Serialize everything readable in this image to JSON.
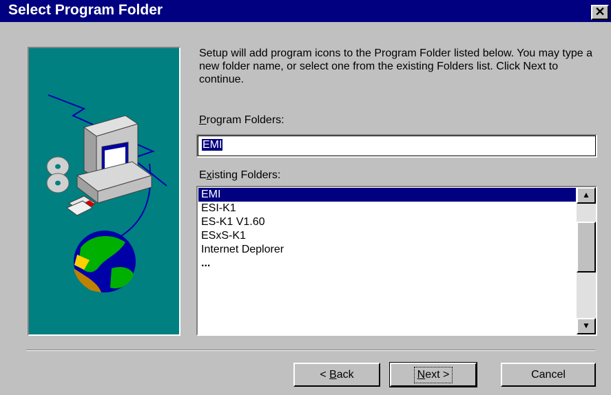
{
  "window": {
    "title": "Select Program Folder",
    "close_glyph": "✕"
  },
  "instructions": "Setup will add program icons to the Program Folder listed below.  You may type a new folder name, or select one from the existing Folders list.  Click Next to continue.",
  "program_folders": {
    "label_prefix": "",
    "label_accel": "P",
    "label_rest": "rogram Folders:",
    "value": "EMI"
  },
  "existing_folders": {
    "label_prefix": "E",
    "label_accel": "x",
    "label_rest": "isting Folders:",
    "items": [
      "EMI",
      "ESI-K1",
      "ES-K1 V1.60",
      "ESxS-K1",
      "Internet Deplorer",
      "..."
    ],
    "selected_index": 0
  },
  "scroll": {
    "up_icon": "▲",
    "down_icon": "▼"
  },
  "buttons": {
    "back": {
      "prefix": "< ",
      "accel": "B",
      "rest": "ack"
    },
    "next": {
      "prefix": "",
      "accel": "N",
      "rest": "ext >"
    },
    "cancel": "Cancel"
  },
  "colors": {
    "title_bar": "#000080",
    "dialog_bg": "#c0c0c0",
    "illustration_bg": "#008080",
    "selection": "#000080"
  },
  "icons": [
    "computer-icon",
    "cd-icon",
    "floppy-disk-icon",
    "globe-icon",
    "close-icon",
    "scroll-up-arrow-icon",
    "scroll-down-arrow-icon"
  ]
}
